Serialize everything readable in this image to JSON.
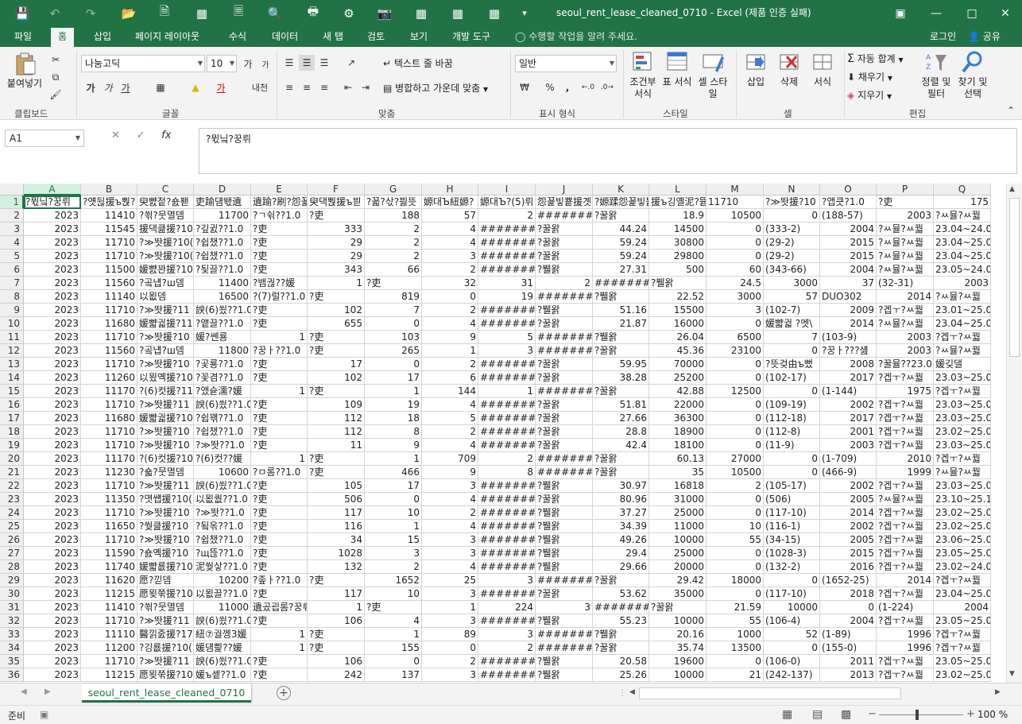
{
  "window": {
    "title": "seoul_rent_lease_cleaned_0710 - Excel (제품 인증 실패)"
  },
  "tabs": [
    "파일",
    "홈",
    "삽입",
    "페이지 레이아웃",
    "수식",
    "데이터",
    "새 탭",
    "검토",
    "보기",
    "개발 도구"
  ],
  "tell_me": "수행할 작업을 알려 주세요.",
  "login": "로그인",
  "share": "공유",
  "ribbon": {
    "clipboard": {
      "paste": "붙여넣기",
      "label": "클립보드"
    },
    "font": {
      "name": "나눔고딕",
      "size": "10",
      "label": "글꼴",
      "grow": "가",
      "shrink": "가",
      "bold": "가",
      "italic": "가",
      "underline": "가",
      "fontcolor": "가",
      "phonetic": "내천"
    },
    "alignment": {
      "wrap": "텍스트 줄 바꿈",
      "merge": "병합하고 가운데 맞춤",
      "label": "맞춤"
    },
    "number": {
      "format": "일반",
      "label": "표시 형식",
      "percent": "%",
      "comma": ","
    },
    "styles": {
      "conditional": "조건부 서식",
      "table": "표 서식",
      "cell": "셀 스타일",
      "label": "스타일"
    },
    "cells": {
      "insert": "삽입",
      "delete": "삭제",
      "format": "서식",
      "label": "셀"
    },
    "editing": {
      "autosum": "자동 합계",
      "fill": "채우기",
      "clear": "지우기",
      "sort": "정렬 및 필터",
      "find": "찾기 및 선택",
      "label": "편집"
    }
  },
  "name_box": "A1",
  "formula": "?뮋닠?꿍뤼",
  "columns": [
    "A",
    "B",
    "C",
    "D",
    "E",
    "F",
    "G",
    "H",
    "I",
    "J",
    "K",
    "L",
    "M",
    "N",
    "O",
    "P",
    "Q"
  ],
  "rows": [
    [
      "?뮋닠?꿍뤼",
      "?얫뒪援ъ뿭?",
      "臾뺤젙?숈퐫",
      "吏踰덈뙋遺",
      "遺踰?刷?怨꾩",
      "臾댁뿭援ъ븯",
      "?꾧?삯?븷뜻",
      "嫄대Ъ紐嫄?",
      "嫄대Ъ?(5)뤼",
      "怨꾩빟뿉援곗젹",
      "?嫄蹂怨꾩빟뿉",
      "援ъ깅옐泥?뜝",
      "11710",
      "?≫똿援?10",
      "?앱큿?1.0",
      "?吏",
      175
    ],
    [
      2023,
      11410,
      "?쐮?뭇멸뎀",
      11700,
      "?ㄱ쉮??1.0",
      "?吏",
      188,
      57,
      2,
      "########",
      "?꿀왉",
      18.9,
      10500,
      0,
      "(188-57)",
      2003,
      "?ㅆ뮬?ㅆ꿟"
    ],
    [
      2023,
      11545,
      "援댁큺援?10",
      "?깊귌??1.0",
      "?吏",
      333,
      2,
      4,
      "########",
      "?꿀왉",
      44.24,
      14500,
      0,
      "(333-2)",
      2004,
      "?ㅆ뮬?ㅆ꿟",
      "23.04~24.0"
    ],
    [
      2023,
      11710,
      "?≫똿援?10(",
      "?쉽챘??1.0",
      "?吏",
      29,
      2,
      4,
      "########",
      "?꿀왉",
      59.24,
      30800,
      0,
      "(29-2)",
      2015,
      "?ㅆ뮬?ㅆ꿟",
      "23.04~25.0"
    ],
    [
      2023,
      11710,
      "?≫똿援?10(",
      "?쉽챘??1.0",
      "?吏",
      29,
      2,
      3,
      "########",
      "?꿀왉",
      59.24,
      29800,
      0,
      "(29-2)",
      2015,
      "?ㅆ뮬?ㅆ꿟",
      "23.04~25.0"
    ],
    [
      2023,
      11500,
      "媛뺤꽌援?10",
      "?됯끌??1.0",
      "?吏",
      343,
      66,
      2,
      "########",
      "?뷀왉",
      27.31,
      500,
      60,
      "(343-66)",
      2004,
      "?ㅆ뮬?ㅆ꿟",
      "23.05~24.0"
    ],
    [
      2023,
      11560,
      "?곸냽?ш뎀",
      11400,
      "?뱀궎??媛",
      1,
      "?吏",
      32,
      31,
      2,
      "########",
      "?뷀왉",
      24.5,
      3000,
      37,
      "(32-31)",
      2003
    ],
    [
      2023,
      11140,
      "以묎뎀",
      16500,
      "?(7)럴??1.0",
      "?吏",
      819,
      0,
      19,
      "########",
      "?뷀왉",
      22.52,
      3000,
      57,
      "DUO302",
      2014,
      "?ㅆ뮬?ㅆ꿟"
    ],
    [
      2023,
      11710,
      "?≫똿援?11",
      "諛(6)쑀??1.0",
      "?吏",
      102,
      7,
      2,
      "########",
      "?뷀왉",
      51.16,
      15500,
      3,
      "(102-7)",
      2009,
      "?겝ㅜ?ㅆ꿟",
      "23.01~25.0"
    ],
    [
      2023,
      11680,
      "媛뺣궓援?11",
      "?앹끌??1.0",
      "?吏",
      655,
      0,
      4,
      "########",
      "?꿀왉",
      21.87,
      16000,
      0,
      "媛뺣궓 ?멧\\",
      2014,
      "?ㅆ뮬?ㅆ꿟",
      "23.04~25.0"
    ],
    [
      2023,
      11710,
      "?≫똿援?10",
      "媛?쎈룡",
      1,
      "?吏",
      103,
      9,
      5,
      "########",
      "?뷀왉",
      26.04,
      6500,
      7,
      "(103-9)",
      2003,
      "?겝ㅜ?ㅆ꿟"
    ],
    [
      2023,
      11560,
      "?곸냽?ш뎀",
      11800,
      "?꿍ㅏ??1.0",
      "?吏",
      265,
      1,
      3,
      "########",
      "?꿀왉",
      45.36,
      23100,
      0,
      "?꿍ㅏ???섎",
      2003,
      "?ㅆ뮬?ㅆ꿟"
    ],
    [
      2023,
      11710,
      "?≫똿援?10",
      "?곷룡??1.0",
      "?吏",
      17,
      0,
      2,
      "########",
      "?꿀왉",
      59.95,
      70000,
      0,
      "?뜻겆由ъ뻤",
      2008,
      "?꿀뮬??23.0",
      "媛깆댈"
    ],
    [
      2023,
      11260,
      "以묐옉援?10",
      "?꽃겸??1.0",
      "?吏",
      102,
      17,
      6,
      "########",
      "?꿀왉",
      38.28,
      25200,
      0,
      "(102-17)",
      2017,
      "?겝ㅜ?ㅆ꿟",
      "23.03~25.0"
    ],
    [
      2023,
      11170,
      "?(6)컷援?11",
      "?앴슏濡?媛",
      1,
      "?吏",
      1,
      144,
      1,
      "########",
      "?꿀왉",
      42.88,
      12500,
      0,
      "(1-144)",
      1975,
      "?겝ㅜ?ㅆ꿟"
    ],
    [
      2023,
      11710,
      "?≫똿援?11",
      "諛(6)쑀??1.0",
      "?吏",
      109,
      19,
      4,
      "########",
      "?꿀왉",
      51.81,
      22000,
      0,
      "(109-19)",
      2002,
      "?겝ㅜ?ㅆ꿟",
      "23.03~25.0"
    ],
    [
      2023,
      11680,
      "媛뺣궓援?10",
      "?쉽꽦??1.0",
      "?吏",
      112,
      18,
      5,
      "########",
      "?꿀왉",
      27.66,
      36300,
      0,
      "(112-18)",
      2017,
      "?겝ㅜ?ㅆ꿟",
      "23.03~25.0"
    ],
    [
      2023,
      11710,
      "?≫똿援?10",
      "?쉽챘??1.0",
      "?吏",
      112,
      8,
      2,
      "########",
      "?꿀왉",
      28.8,
      18900,
      0,
      "(112-8)",
      2001,
      "?겝ㅜ?ㅆ꿟",
      "23.02~25.0"
    ],
    [
      2023,
      11710,
      "?≫똿援?10",
      "?≫똿??1.0",
      "?吏",
      11,
      9,
      4,
      "########",
      "?꿀왉",
      42.4,
      18100,
      0,
      "(11-9)",
      2003,
      "?겝ㅜ?ㅆ꿟",
      "23.03~25.0"
    ],
    [
      2023,
      11170,
      "?(6)컷援?10",
      "?(6)컷??媛",
      1,
      "?吏",
      1,
      709,
      2,
      "########",
      "?꿀왉",
      60.13,
      27000,
      0,
      "(1-709)",
      2010,
      "?겝ㅜ?ㅆ꿟"
    ],
    [
      2023,
      11230,
      "?숇?뭇멸뎀",
      10600,
      "?ㅁ롬??1.0",
      "?吏",
      466,
      9,
      8,
      "########",
      "?꿀왉",
      35,
      10500,
      0,
      "(466-9)",
      1999,
      "?ㅆ뮬?ㅆ꿟"
    ],
    [
      2023,
      11710,
      "?≫똿援?11",
      "諛(6)쑀??1.0",
      "?吏",
      105,
      17,
      3,
      "########",
      "?뷀왉",
      30.97,
      16818,
      2,
      "(105-17)",
      2002,
      "?겝ㅜ?ㅆ꿟",
      "23.03~25.0"
    ],
    [
      2023,
      11350,
      "?몃썝援?10(",
      "以묎퀎??1.0",
      "?吏",
      506,
      0,
      4,
      "########",
      "?꿀왉",
      80.96,
      31000,
      0,
      "(506)",
      2005,
      "?ㅆ뮬?ㅆ꿟",
      "23.10~25.1"
    ],
    [
      2023,
      11710,
      "?≫똿援?10",
      "?≫똿??1.0",
      "?吏",
      117,
      10,
      2,
      "########",
      "?뷀왉",
      37.27,
      25000,
      0,
      "(117-10)",
      2014,
      "?겝ㅜ?ㅆ꿟",
      "23.02~25.0"
    ],
    [
      2023,
      11650,
      "?쒖큺援?10",
      "?됰옦??1.0",
      "?吏",
      116,
      1,
      4,
      "########",
      "?뷀왉",
      34.39,
      11000,
      10,
      "(116-1)",
      2002,
      "?겝ㅜ?ㅆ꿟",
      "23.02~25.0"
    ],
    [
      2023,
      11710,
      "?≫똿援?10",
      "?쉽챘??1.0",
      "?吏",
      34,
      15,
      3,
      "########",
      "?뷀왉",
      49.26,
      10000,
      55,
      "(34-15)",
      2005,
      "?겝ㅜ?ㅆ꿟",
      "23.06~25.0"
    ],
    [
      2023,
      11590,
      "?숈옉援?10",
      "?щ뜮??1.0",
      "?吏",
      1028,
      3,
      3,
      "########",
      "?뷀왉",
      29.4,
      25000,
      0,
      "(1028-3)",
      2015,
      "?겝ㅜ?ㅆ꿟",
      "23.05~25.0"
    ],
    [
      2023,
      11740,
      "媛뺣룞援?10",
      "泥쒖샇??1.0",
      "?吏",
      132,
      2,
      4,
      "########",
      "?뷀왉",
      29.66,
      20000,
      0,
      "(132-2)",
      2016,
      "?겝ㅜ?ㅆ꿟",
      "23.02~24.0"
    ],
    [
      2023,
      11620,
      "愿?낃뎀",
      10200,
      "?좊ㅏ??1.0",
      "?吏",
      1652,
      25,
      3,
      "########",
      "?꿀왉",
      29.42,
      18000,
      0,
      "(1652-25)",
      2014,
      "?겝ㅜ?ㅆ꿟"
    ],
    [
      2023,
      11215,
      "愿묒쭊援?10",
      "以묎끌??1.0",
      "?吏",
      117,
      10,
      3,
      "########",
      "?꿀왉",
      53.62,
      35000,
      0,
      "(117-10)",
      2018,
      "?겝ㅜ?ㅆ꿟",
      "23.04~25.0"
    ],
    [
      2023,
      11410,
      "?쐮?뭇멸뎀",
      11000,
      "遺곴굅롬?꿍뤼",
      1,
      "?吏",
      1,
      224,
      3,
      "########",
      "?꿀왉",
      21.59,
      10000,
      0,
      "(1-224)",
      2004
    ],
    [
      2023,
      11710,
      "?≫똿援?11",
      "諛(6)쑀??1.0",
      "?吏",
      106,
      4,
      3,
      "########",
      "?뷀왉",
      55.23,
      10000,
      55,
      "(106-4)",
      2004,
      "?겝ㅜ?ㅆ꿟",
      "23.05~25.0"
    ],
    [
      2023,
      11110,
      "醫낅줈援?17",
      "紐⑦궐껭3媛",
      1,
      "?吏",
      1,
      89,
      3,
      "########",
      "?뷀왉",
      20.16,
      1000,
      52,
      "(1-89)",
      1996,
      "?겝ㅜ?ㅆ꿟"
    ],
    [
      2023,
      11200,
      "?깅룞援?10(",
      "媛덈삁??媛",
      1,
      "?吏",
      155,
      0,
      2,
      "########",
      "?꿀왉",
      35.74,
      13500,
      0,
      "(155-0)",
      1996,
      "?겝ㅜ?ㅆ꿟"
    ],
    [
      2023,
      11710,
      "?≫똿援?11",
      "諛(6)쑀??1.0",
      "?吏",
      106,
      0,
      2,
      "########",
      "?뷀왉",
      20.58,
      19600,
      0,
      "(106-0)",
      2011,
      "?겝ㅜ?ㅆ꿟",
      "23.05~25.0"
    ],
    [
      2023,
      11215,
      "愿묒쭊援?10",
      "媛ъ솉??1.0",
      "?吏",
      242,
      137,
      3,
      "########",
      "?뷀왉",
      25.26,
      10000,
      21,
      "(242-137)",
      2013,
      "?겝ㅜ?ㅆ꿟",
      "23.02~25.0"
    ]
  ],
  "sheet_tab": "seoul_rent_lease_cleaned_0710",
  "status": {
    "ready": "준비",
    "zoom": "100 %"
  },
  "colors": {
    "accent": "#217346"
  }
}
